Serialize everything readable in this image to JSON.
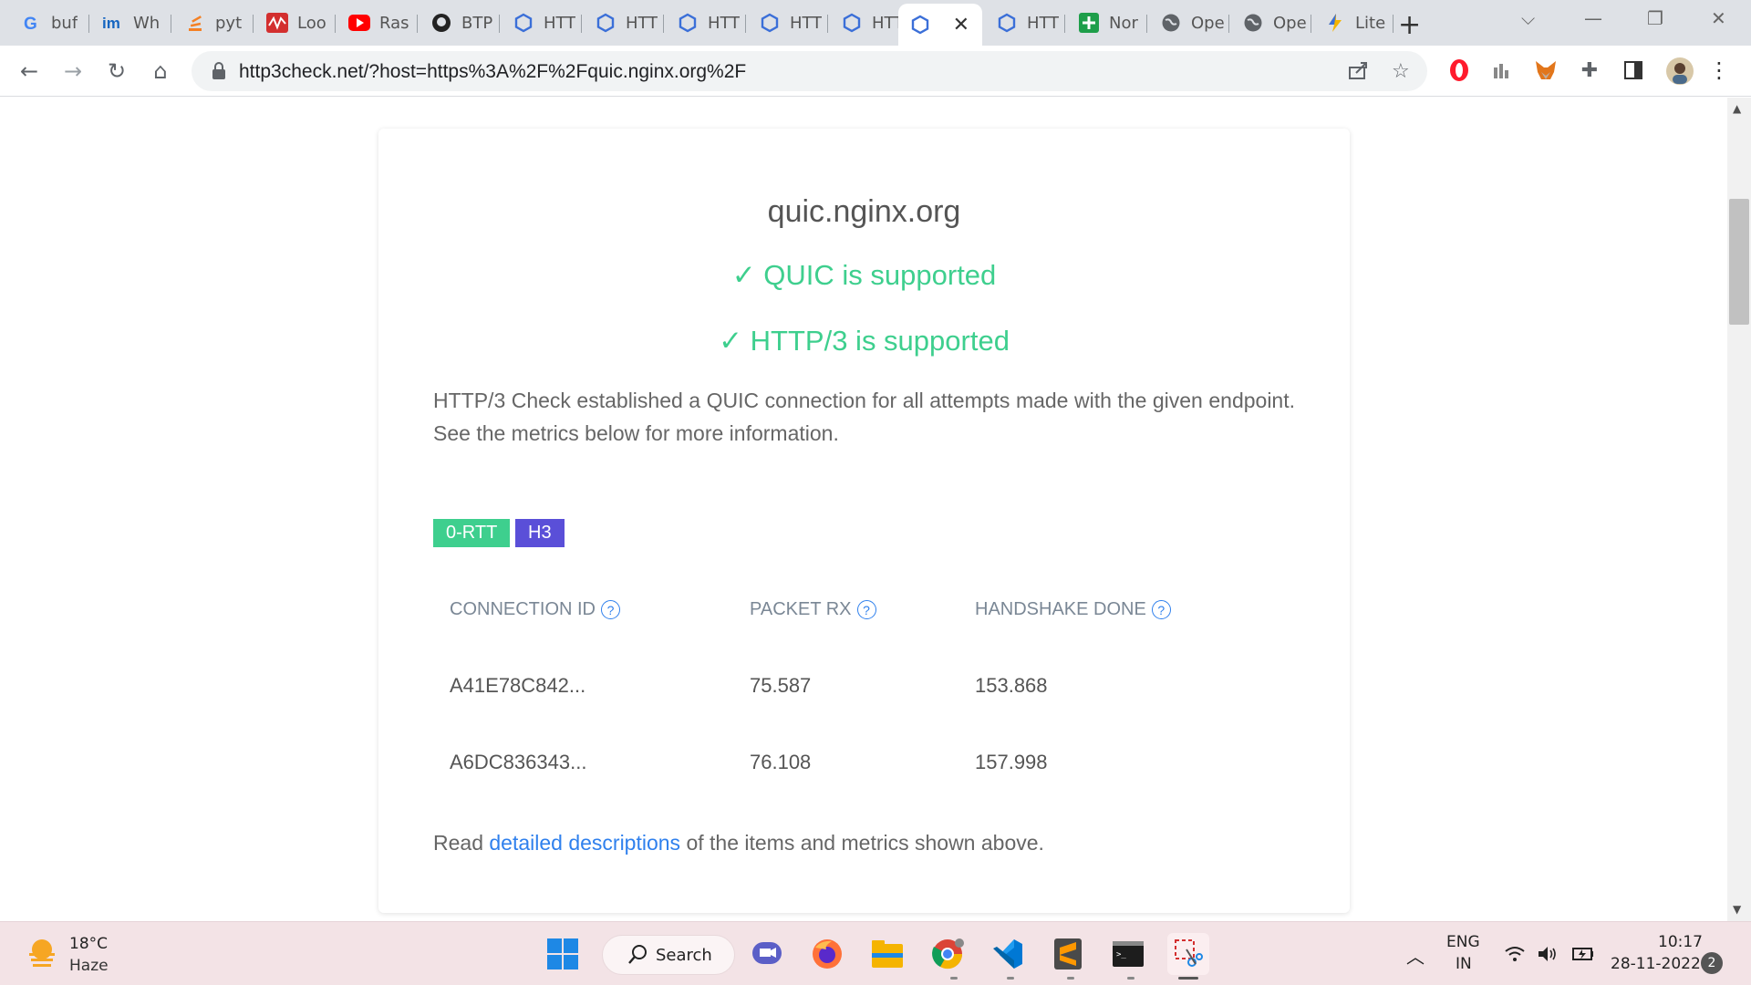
{
  "browser": {
    "tabs": [
      {
        "label": "buf",
        "icon": "google-icon"
      },
      {
        "label": "Wh",
        "icon": "im-icon"
      },
      {
        "label": "pyt",
        "icon": "stackoverflow-icon"
      },
      {
        "label": "Loo",
        "icon": "analytics-icon"
      },
      {
        "label": "Ras",
        "icon": "youtube-icon"
      },
      {
        "label": "BTP",
        "icon": "github-icon"
      },
      {
        "label": "HTT",
        "icon": "hexagon-icon"
      },
      {
        "label": "HTT",
        "icon": "hexagon-icon"
      },
      {
        "label": "HTT",
        "icon": "hexagon-icon"
      },
      {
        "label": "HTT",
        "icon": "hexagon-icon"
      },
      {
        "label": "HTT",
        "icon": "hexagon-icon"
      },
      {
        "label": "",
        "icon": "hexagon-icon",
        "active": true
      },
      {
        "label": "HTT",
        "icon": "hexagon-icon"
      },
      {
        "label": "Nor",
        "icon": "plus-green-icon"
      },
      {
        "label": "Ope",
        "icon": "globe-icon"
      },
      {
        "label": "Ope",
        "icon": "globe-icon"
      },
      {
        "label": "Lite",
        "icon": "bolt-icon"
      }
    ],
    "close_glyph": "✕",
    "new_tab_glyph": "+",
    "address": "http3check.net/?host=https%3A%2F%2Fquic.nginx.org%2F"
  },
  "page": {
    "host": "quic.nginx.org",
    "quic_status": "✓ QUIC is supported",
    "http3_status": "✓ HTTP/3 is supported",
    "description": "HTTP/3 Check established a QUIC connection for all attempts made with the given endpoint. See the metrics below for more information.",
    "badges": [
      {
        "label": "0-RTT",
        "color": "#3ecf8e"
      },
      {
        "label": "H3",
        "color": "#5a4fd8"
      }
    ],
    "table": {
      "headers": [
        "CONNECTION ID",
        "PACKET RX",
        "HANDSHAKE DONE"
      ],
      "help_glyph": "?",
      "rows": [
        [
          "A41E78C842...",
          "75.587",
          "153.868"
        ],
        [
          "A6DC836343...",
          "76.108",
          "157.998"
        ]
      ]
    },
    "footer": {
      "before": "Read ",
      "link": "detailed descriptions",
      "after": " of the items and metrics shown above."
    }
  },
  "taskbar": {
    "weather": {
      "temp": "18°C",
      "condition": "Haze"
    },
    "search_label": "Search",
    "language": {
      "line1": "ENG",
      "line2": "IN"
    },
    "clock": {
      "time": "10:17",
      "date": "28-11-2022"
    },
    "notification_count": "2"
  },
  "colors": {
    "success": "#3ecf8e",
    "link": "#2f80ed",
    "h3_badge": "#5a4fd8"
  }
}
